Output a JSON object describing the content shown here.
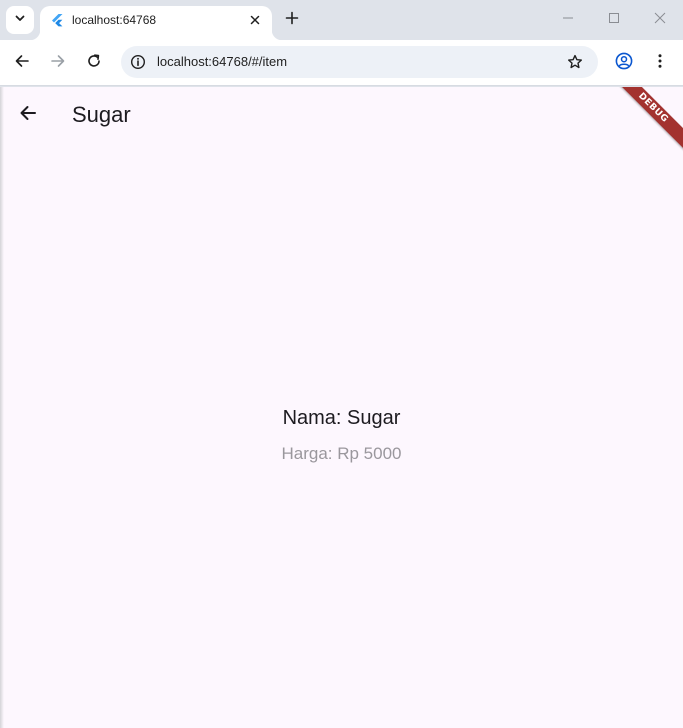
{
  "browser": {
    "tab": {
      "title": "localhost:64768"
    },
    "address": {
      "url": "localhost:64768/#/item"
    }
  },
  "app": {
    "title": "Sugar",
    "debug_banner": "DEBUG",
    "item": {
      "name_line": "Nama: Sugar",
      "price_line": "Harga: Rp 5000"
    }
  },
  "colors": {
    "page_background": "#fdf7fe",
    "debug_banner": "#a3322f",
    "price_text": "#9a979d",
    "flutter_blue": "#42a5f5"
  },
  "icons": {
    "tab_search": "chevron-down-icon",
    "favicon": "flutter-icon",
    "tab_close": "close-icon",
    "new_tab": "plus-icon",
    "back": "arrow-left-icon",
    "forward": "arrow-right-icon",
    "reload": "reload-icon",
    "site_info": "info-icon",
    "bookmark": "star-icon",
    "profile": "profile-icon",
    "menu": "more-vert-icon"
  }
}
